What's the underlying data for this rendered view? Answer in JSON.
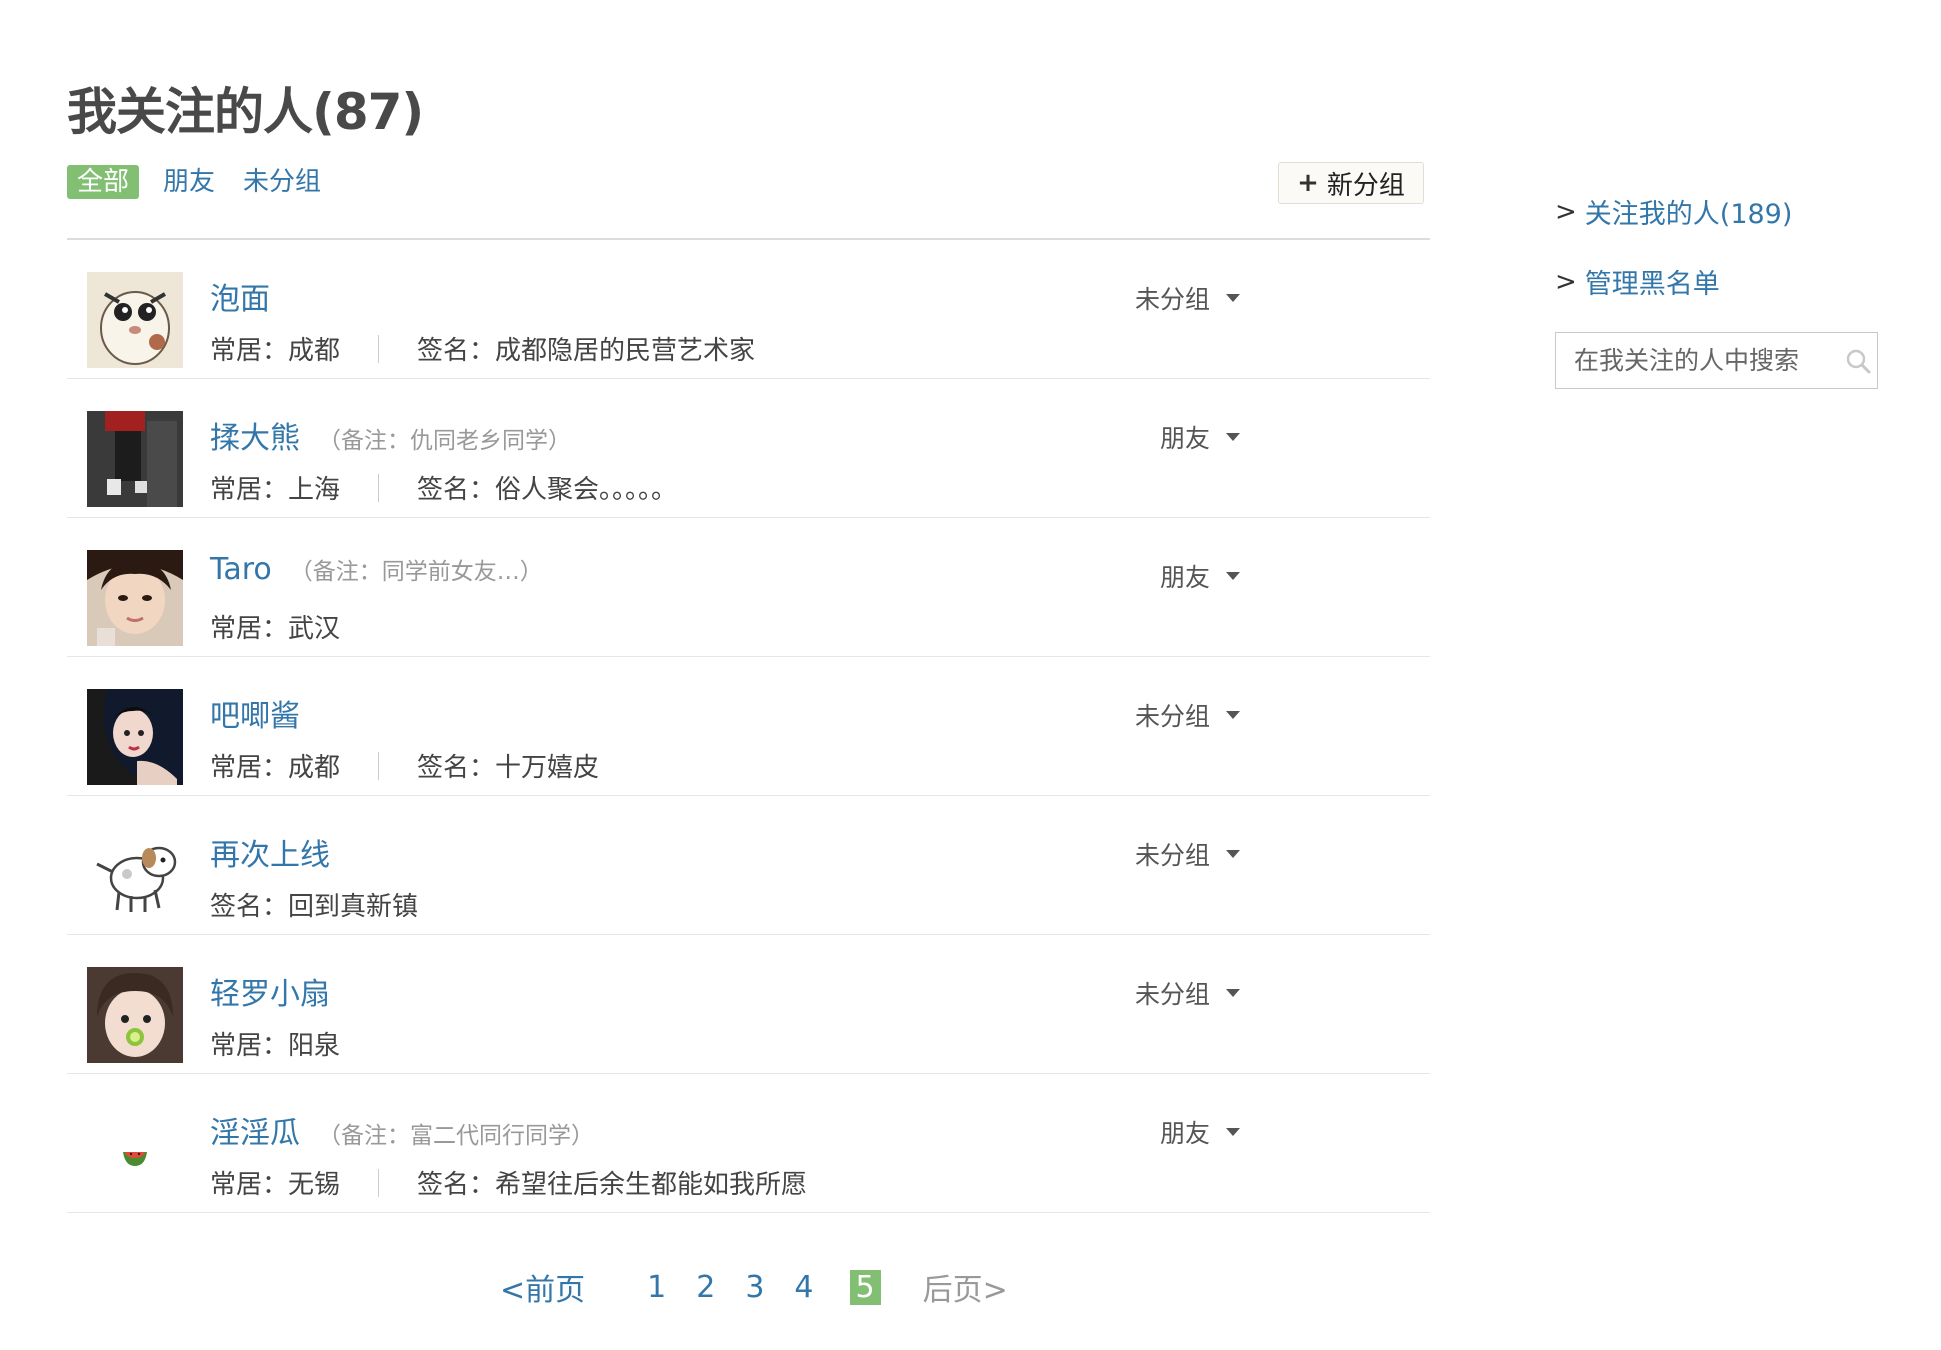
{
  "title": "我关注的人(87)",
  "tabs": [
    {
      "label": "全部",
      "active": true
    },
    {
      "label": "朋友",
      "active": false
    },
    {
      "label": "未分组",
      "active": false
    }
  ],
  "new_group": {
    "plus": "+",
    "label": "新分组"
  },
  "people": [
    {
      "name": "泡面",
      "note": "",
      "location_label": "常居：",
      "location": "成都",
      "signature_label": "签名：",
      "signature": "成都隐居的民营艺术家",
      "group": "未分组"
    },
    {
      "name": "揉大熊",
      "note": "（备注：仇同老乡同学）",
      "location_label": "常居：",
      "location": "上海",
      "signature_label": "签名：",
      "signature": "俗人聚会。。。。。",
      "group": "朋友"
    },
    {
      "name": "Taro",
      "note": "（备注：同学前女友…）",
      "location_label": "常居：",
      "location": "武汉",
      "signature_label": "",
      "signature": "",
      "group": "朋友"
    },
    {
      "name": "吧唧酱",
      "note": "",
      "location_label": "常居：",
      "location": "成都",
      "signature_label": "签名：",
      "signature": "十万嬉皮",
      "group": "未分组"
    },
    {
      "name": "再次上线",
      "note": "",
      "location_label": "",
      "location": "",
      "signature_label": "签名：",
      "signature": "回到真新镇",
      "group": "未分组"
    },
    {
      "name": "轻罗小扇",
      "note": "",
      "location_label": "常居：",
      "location": "阳泉",
      "signature_label": "",
      "signature": "",
      "group": "未分组"
    },
    {
      "name": "淫淫瓜",
      "note": "（备注：富二代同行同学）",
      "location_label": "常居：",
      "location": "无锡",
      "signature_label": "签名：",
      "signature": "希望往后余生都能如我所愿",
      "group": "朋友"
    }
  ],
  "pagination": {
    "prev": "<前页",
    "pages": [
      "1",
      "2",
      "3",
      "4"
    ],
    "current": "5",
    "next": "后页>"
  },
  "sidebar": {
    "followers": {
      "arrow": ">",
      "label": "关注我的人(189)"
    },
    "blacklist": {
      "arrow": ">",
      "label": "管理黑名单"
    },
    "search_placeholder": "在我关注的人中搜索"
  },
  "colors": {
    "link": "#3377aa",
    "accent_green": "#83bf73",
    "title": "#494949",
    "muted": "#999999"
  },
  "icons": {
    "search": "search-icon",
    "dropdown": "caret-down-icon",
    "plus": "plus-icon"
  }
}
